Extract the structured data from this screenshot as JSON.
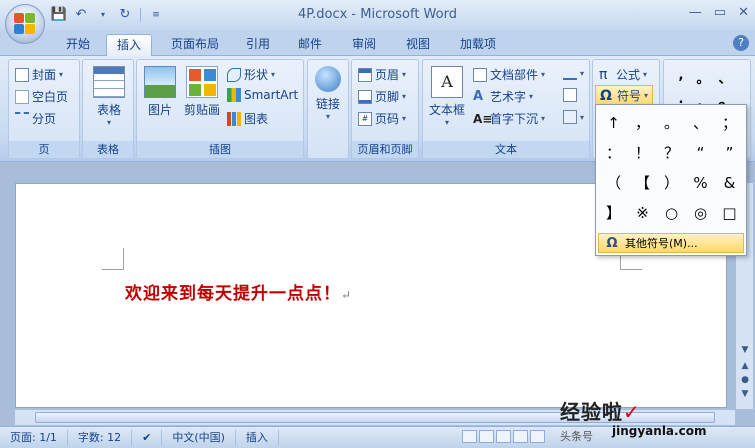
{
  "window": {
    "title": "4P.docx - Microsoft Word"
  },
  "tabs": [
    "开始",
    "插入",
    "页面布局",
    "引用",
    "邮件",
    "审阅",
    "视图",
    "加载项"
  ],
  "active_tab": "插入",
  "ribbon": {
    "page_group": {
      "label": "页",
      "cover": "封面",
      "blank": "空白页",
      "break": "分页"
    },
    "table_group": {
      "label": "表格",
      "table": "表格"
    },
    "illustrations_group": {
      "label": "插图",
      "picture": "图片",
      "clipart": "剪贴画",
      "shapes": "形状",
      "smartart": "SmartArt",
      "chart": "图表"
    },
    "links_group": {
      "link": "链接"
    },
    "header_footer_group": {
      "label": "页眉和页脚",
      "header": "页眉",
      "footer": "页脚",
      "page_number": "页码"
    },
    "text_group": {
      "label": "文本",
      "textbox": "文本框",
      "quick_parts": "文档部件",
      "wordart": "艺术字",
      "dropcap": "首字下沉"
    },
    "symbols_group": {
      "equation": "公式",
      "symbol": "符号"
    },
    "mini_symbols": [
      ",",
      "。",
      "、",
      ";",
      "：",
      "？"
    ]
  },
  "symbol_dropdown": {
    "symbols": [
      "↑",
      "，",
      "。",
      "、",
      "；",
      "：",
      "！",
      "？",
      "“",
      "”",
      "（",
      "【",
      "）",
      "%",
      "&",
      "】",
      "※",
      "○",
      "◎",
      "□"
    ],
    "more": "其他符号(M)..."
  },
  "document": {
    "text": "欢迎来到每天提升一点点！"
  },
  "status": {
    "page": "页面: 1/1",
    "words": "字数: 12",
    "language": "中文(中国)",
    "mode": "插入"
  },
  "watermark": {
    "main": "经验啦",
    "sub": "jingyanla.com",
    "small": "头条号"
  }
}
